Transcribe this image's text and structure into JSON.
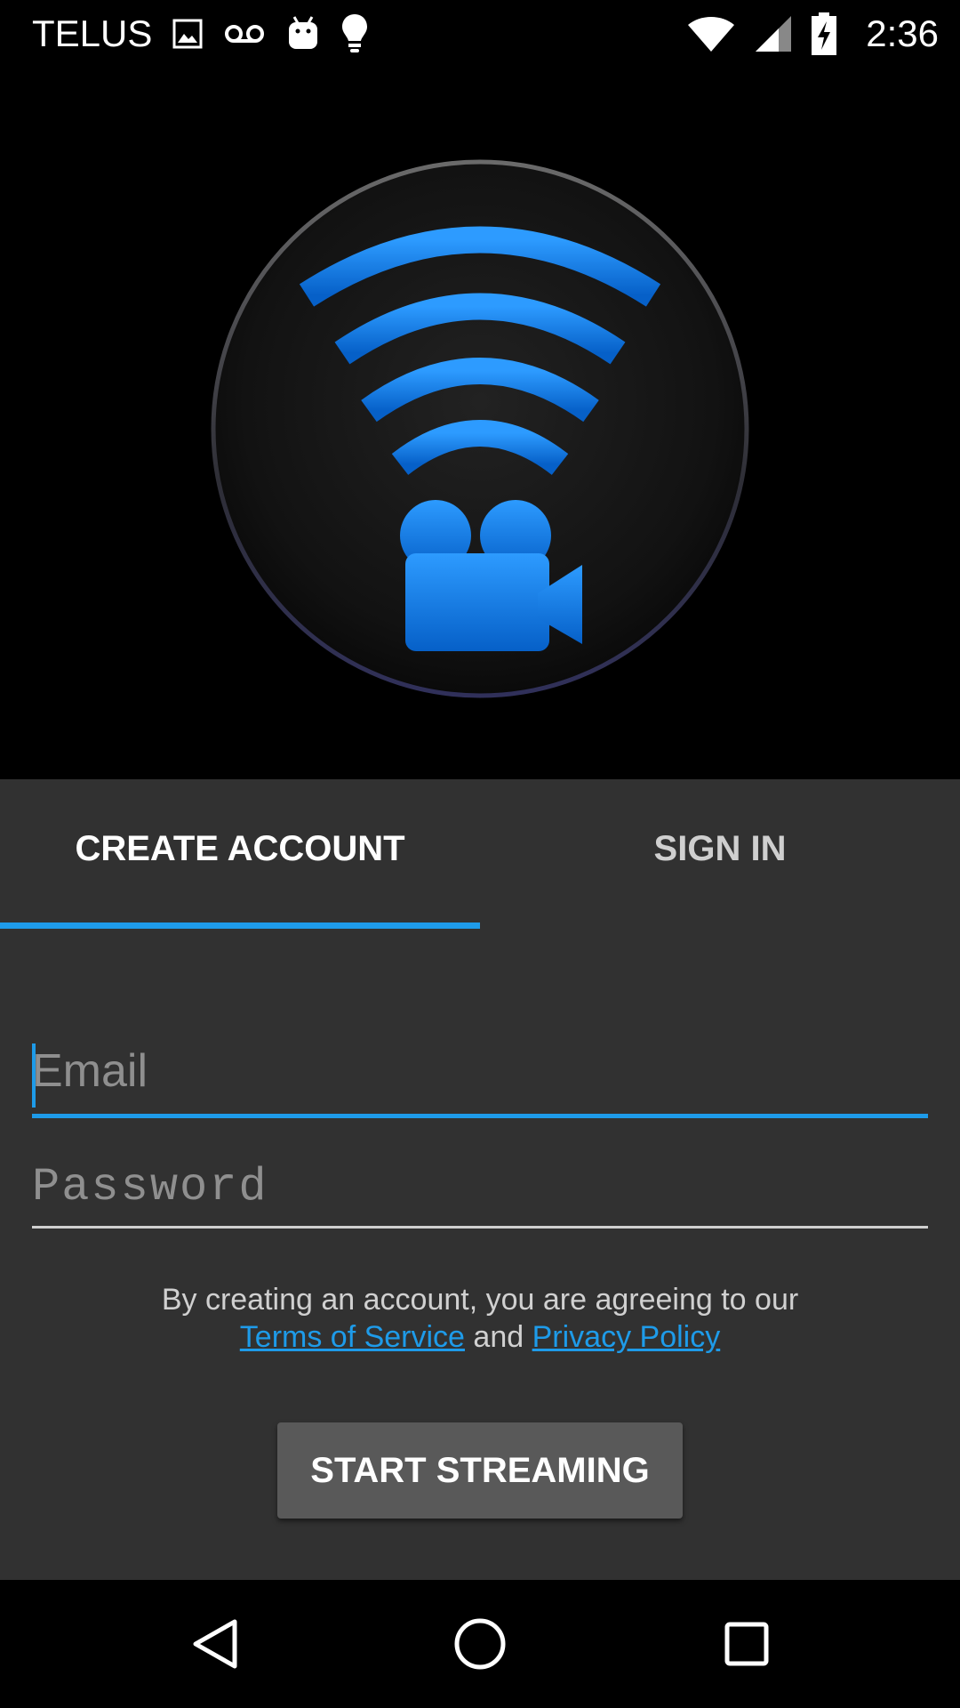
{
  "status_bar": {
    "carrier": "TELUS",
    "time": "2:36",
    "icons": [
      "image-icon",
      "voicemail-icon",
      "android-icon",
      "lightbulb-icon",
      "wifi-icon",
      "cell-signal-icon",
      "battery-charging-icon"
    ]
  },
  "hero": {
    "logo_icon": "wifi-video-camera-logo",
    "accent_color": "#1e9be9"
  },
  "tabs": [
    {
      "label": "CREATE ACCOUNT",
      "selected": true
    },
    {
      "label": "SIGN IN",
      "selected": false
    }
  ],
  "form": {
    "email_placeholder": "Email",
    "email_value": "",
    "password_placeholder": "Password",
    "password_value": ""
  },
  "terms": {
    "prefix": "By creating an account, you are agreeing to our",
    "terms_link": "Terms of Service",
    "conjunction": "and",
    "privacy_link": "Privacy Policy"
  },
  "primary_button": {
    "label": "START STREAMING"
  },
  "nav_bar": {
    "icons": [
      "back-icon",
      "home-icon",
      "recents-icon"
    ]
  }
}
